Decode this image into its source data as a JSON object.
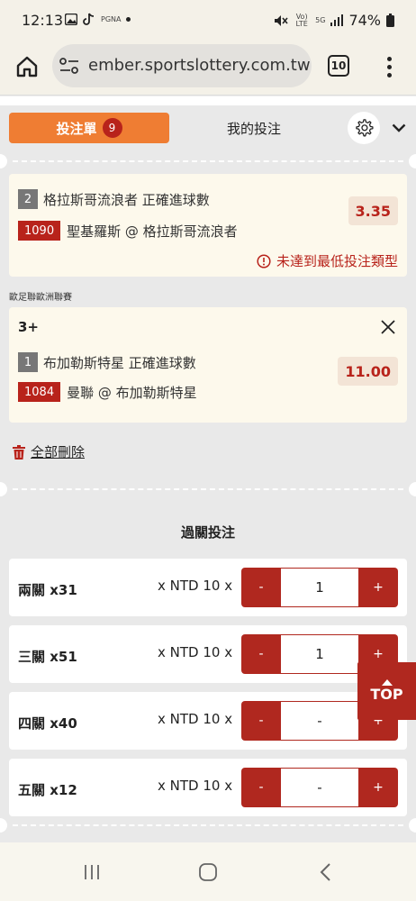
{
  "status_bar": {
    "time": "12:13",
    "battery": "74%",
    "notif_label": "PGNA",
    "volte_label": "Vo) LTE",
    "network_label": "5G"
  },
  "browser": {
    "url": "ember.sportslottery.com.tw",
    "tab_count": "10"
  },
  "header": {
    "bet_slip_label": "投注單",
    "bet_count": "9",
    "my_bets_label": "我的投注"
  },
  "bets": [
    {
      "leg_number": "2",
      "market": "格拉斯哥流浪者 正確進球數",
      "match_id": "1090",
      "match": "聖基羅斯 @ 格拉斯哥流浪者",
      "odds": "3.35",
      "warning": "未達到最低投注類型"
    },
    {
      "league": "歐足聯歐洲聯賽",
      "selection": "3+",
      "leg_number": "1",
      "market": "布加勒斯特星 正確進球數",
      "match_id": "1084",
      "match": "曼聯 @ 布加勒斯特星",
      "odds": "11.00"
    }
  ],
  "delete_all_label": "全部刪除",
  "parlay": {
    "title": "過關投注",
    "rows": [
      {
        "label": "兩關 x31",
        "unit": "x NTD 10 x",
        "value": "1"
      },
      {
        "label": "三關 x51",
        "unit": "x NTD 10 x",
        "value": "1"
      },
      {
        "label": "四關 x40",
        "unit": "x NTD 10 x",
        "value": "-"
      },
      {
        "label": "五關 x12",
        "unit": "x NTD 10 x",
        "value": "-"
      }
    ],
    "minus_label": "-",
    "plus_label": "+"
  },
  "top_button_label": "TOP",
  "colors": {
    "accent_orange": "#ef7d33",
    "brand_red": "#b0281f",
    "card_bg": "#fdf9ec"
  },
  "icons": [
    "home-icon",
    "site-settings-icon",
    "tabs-icon",
    "more-vert-icon",
    "gear-icon",
    "chevron-down-icon",
    "warning-circle-icon",
    "close-icon",
    "trash-icon",
    "arrow-up-icon",
    "recents-icon",
    "home-nav-icon",
    "back-icon"
  ]
}
